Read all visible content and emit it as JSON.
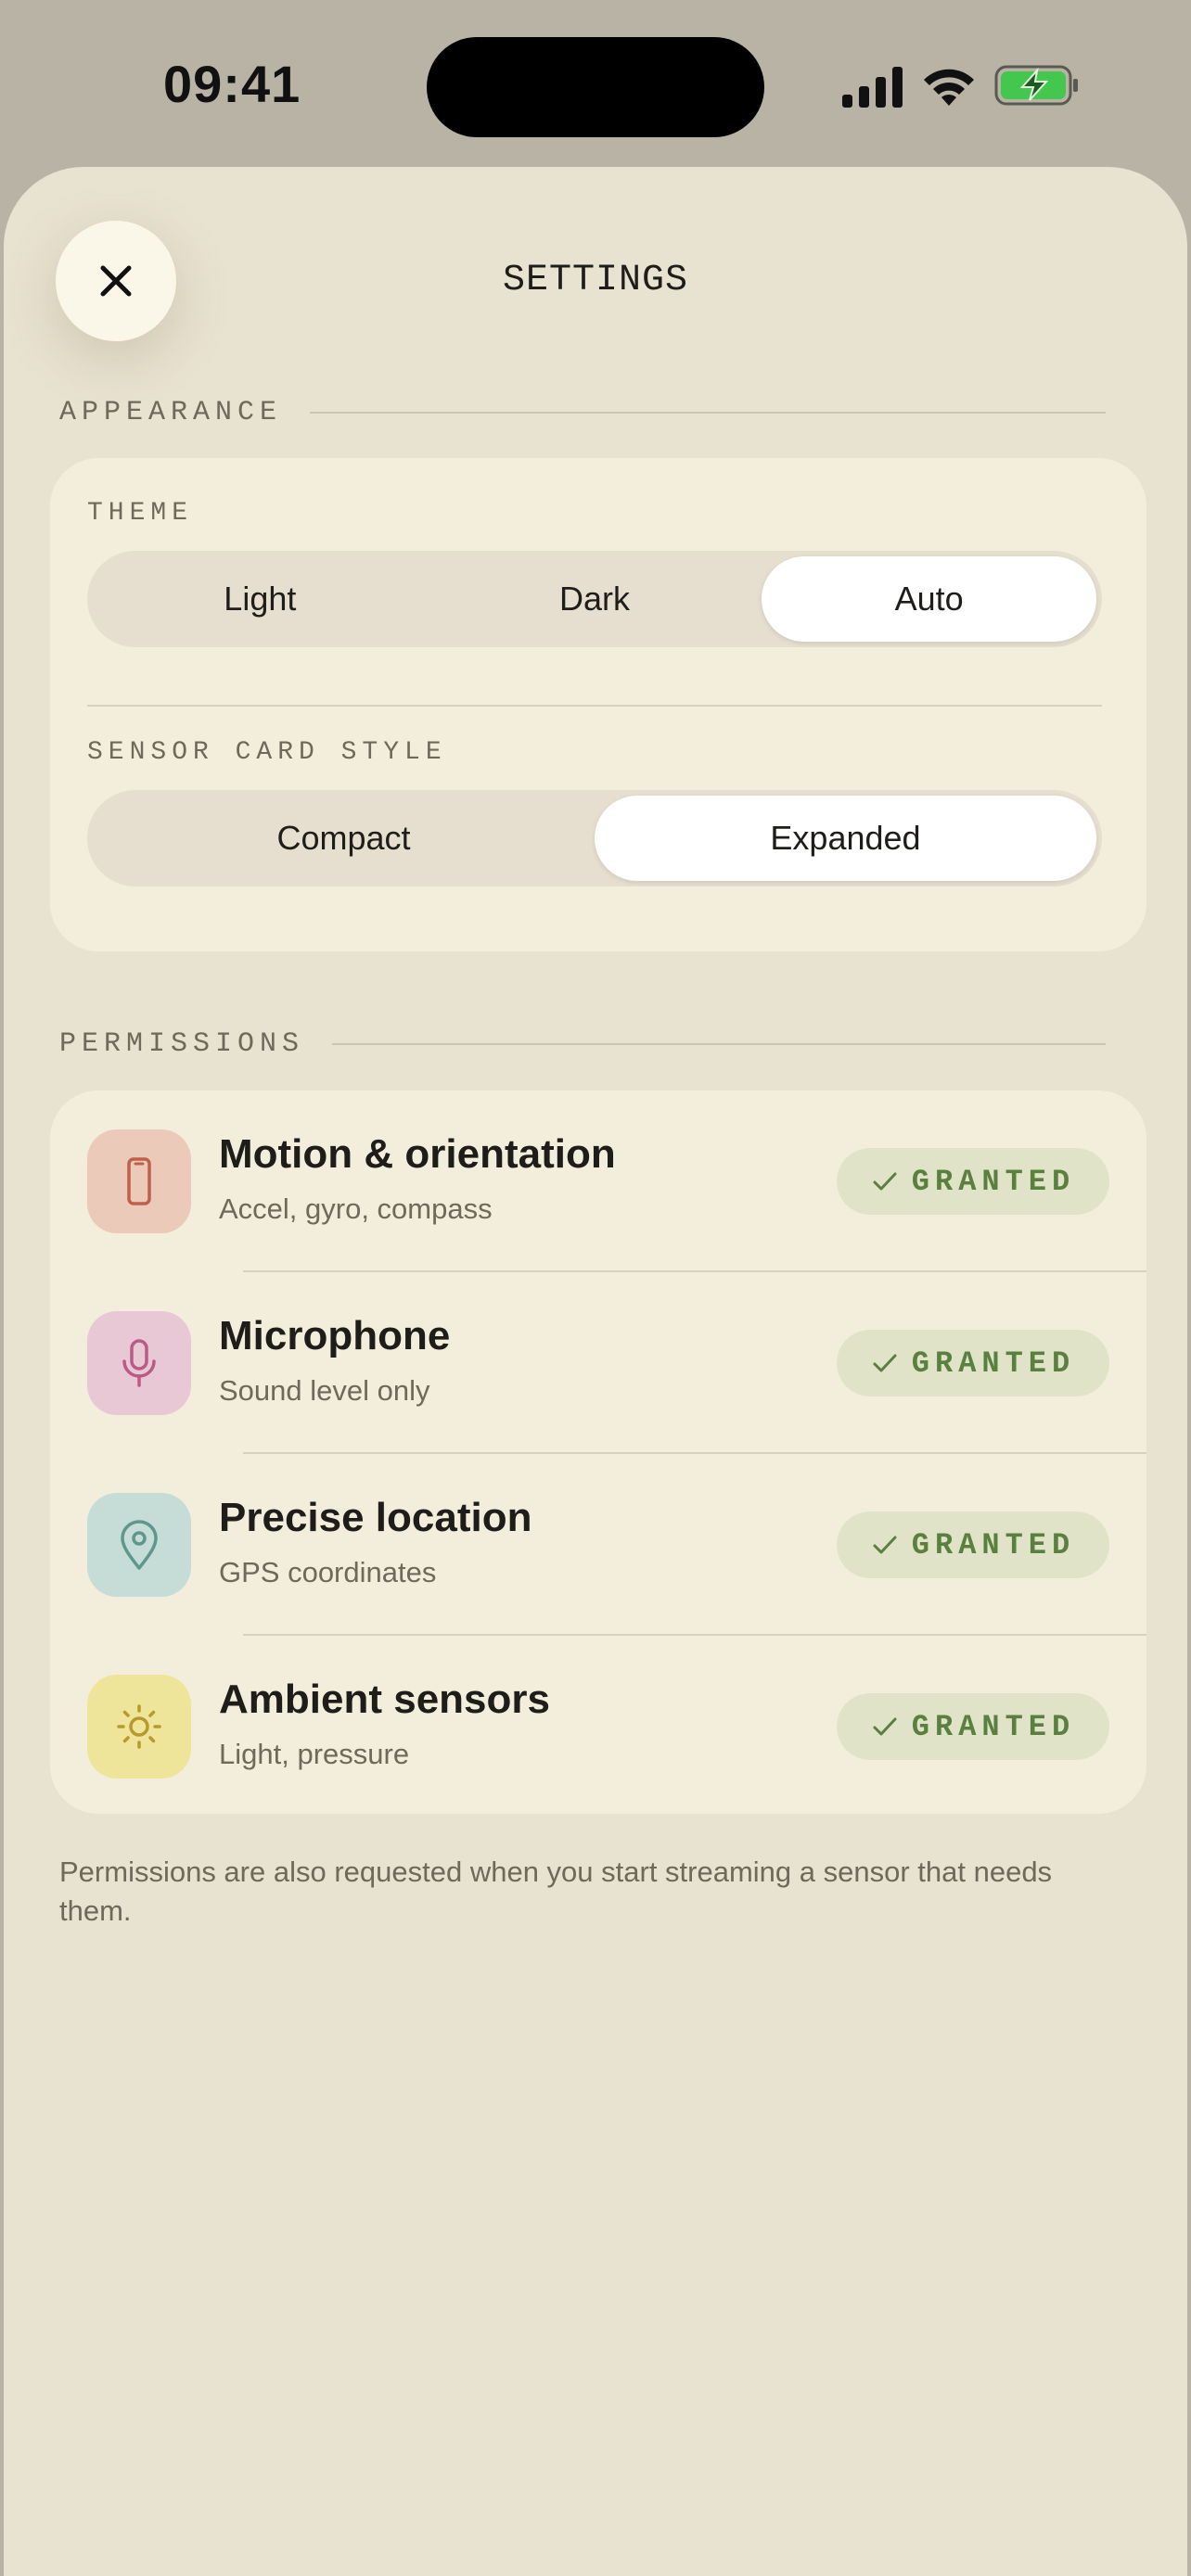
{
  "status_bar": {
    "time": "09:41"
  },
  "header": {
    "title": "SETTINGS",
    "close_icon": "close-icon"
  },
  "appearance": {
    "section_label": "APPEARANCE",
    "theme": {
      "label": "THEME",
      "options": [
        "Light",
        "Dark",
        "Auto"
      ],
      "selected": "Auto"
    },
    "card_style": {
      "label": "SENSOR CARD STYLE",
      "options": [
        "Compact",
        "Expanded"
      ],
      "selected": "Expanded"
    }
  },
  "permissions": {
    "section_label": "PERMISSIONS",
    "items": [
      {
        "title": "Motion & orientation",
        "subtitle": "Accel, gyro, compass",
        "status": "GRANTED",
        "icon": "phone-icon",
        "icon_bg": "#eccaba",
        "icon_color": "#c0604a"
      },
      {
        "title": "Microphone",
        "subtitle": "Sound level only",
        "status": "GRANTED",
        "icon": "microphone-icon",
        "icon_bg": "#e9c8d6",
        "icon_color": "#b95b85"
      },
      {
        "title": "Precise location",
        "subtitle": "GPS coordinates",
        "status": "GRANTED",
        "icon": "location-pin-icon",
        "icon_bg": "#c6dcd6",
        "icon_color": "#5f968e"
      },
      {
        "title": "Ambient sensors",
        "subtitle": "Light, pressure",
        "status": "GRANTED",
        "icon": "sun-icon",
        "icon_bg": "#efe59a",
        "icon_color": "#b79a2c"
      }
    ]
  },
  "footnote": "Permissions are also requested when you start streaming a sensor that needs them.",
  "colors": {
    "sheet_bg": "#e8e2d0",
    "card_bg": "#f3eedc",
    "granted_text": "#5a8040",
    "granted_bg": "#e1e3c8"
  }
}
